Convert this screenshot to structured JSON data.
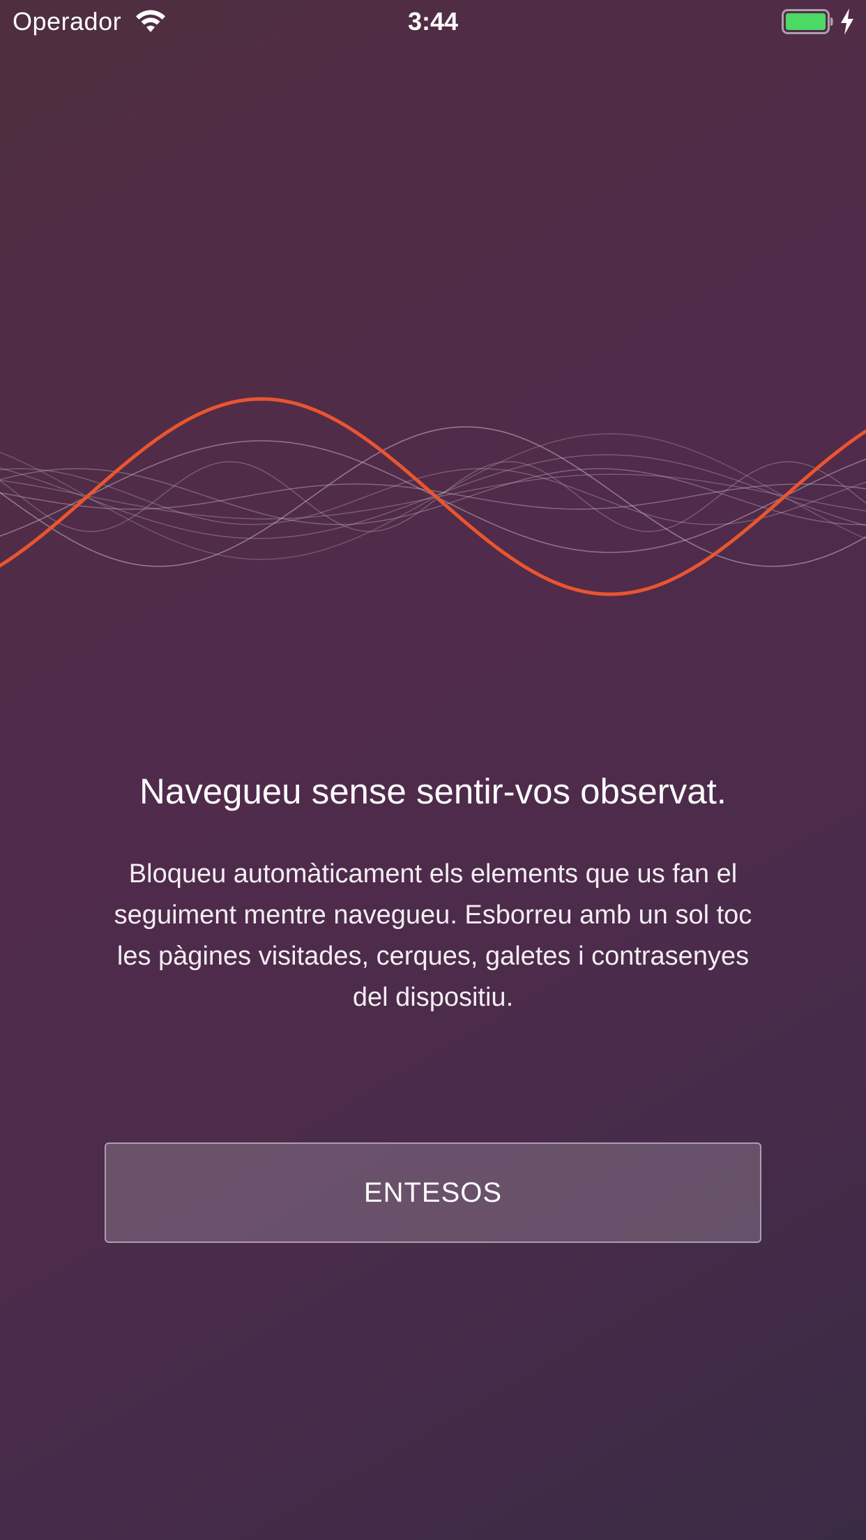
{
  "status_bar": {
    "carrier": "Operador",
    "time": "3:44",
    "wifi_icon": "wifi-icon",
    "battery_icon": "battery-icon",
    "charging_icon": "charging-bolt-icon",
    "battery_level": 1.0,
    "battery_color": "#4cd964"
  },
  "illustration": {
    "name": "wave-illustration",
    "accent_color": "#e9552f"
  },
  "onboarding": {
    "headline": "Navegueu sense sentir-vos observat.",
    "body": "Bloqueu automàticament els elements que us fan el seguiment mentre navegueu. Esborreu amb un sol toc les pàgines visitades, cerques, galetes i contrasenyes del dispositiu.",
    "button_label": "ENTESOS"
  }
}
